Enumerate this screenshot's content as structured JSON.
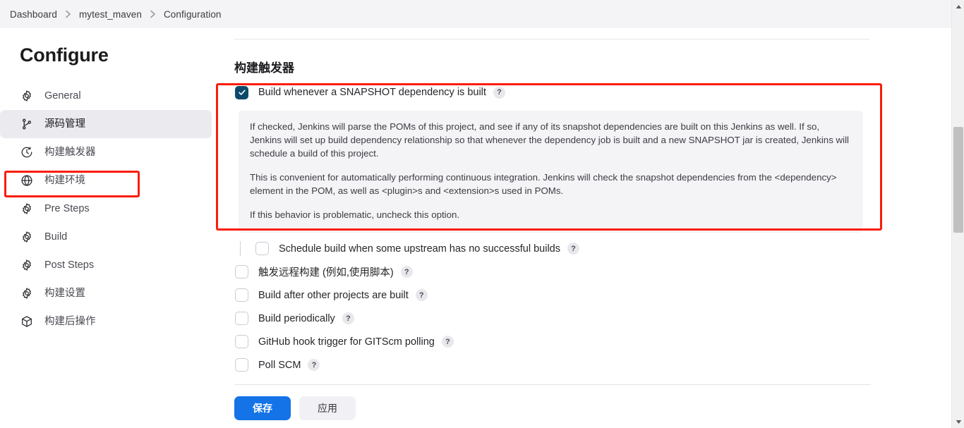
{
  "breadcrumb": {
    "items": [
      {
        "label": "Dashboard"
      },
      {
        "label": "mytest_maven"
      },
      {
        "label": "Configuration"
      }
    ],
    "separator_icon": "chevron-right-icon"
  },
  "sidebar": {
    "title": "Configure",
    "items": [
      {
        "label": "General",
        "icon": "gear-icon",
        "active": false
      },
      {
        "label": "源码管理",
        "icon": "source-branch-icon",
        "active": true
      },
      {
        "label": "构建触发器",
        "icon": "clock-icon",
        "active": false,
        "highlighted": true
      },
      {
        "label": "构建环境",
        "icon": "globe-icon",
        "active": false
      },
      {
        "label": "Pre Steps",
        "icon": "gear-icon",
        "active": false
      },
      {
        "label": "Build",
        "icon": "gear-icon",
        "active": false
      },
      {
        "label": "Post Steps",
        "icon": "gear-icon",
        "active": false
      },
      {
        "label": "构建设置",
        "icon": "gear-icon",
        "active": false
      },
      {
        "label": "构建后操作",
        "icon": "package-icon",
        "active": false
      }
    ]
  },
  "main": {
    "section_title": "构建触发器",
    "primary_trigger": {
      "label": "Build whenever a SNAPSHOT dependency is built",
      "checked": true,
      "help_badge": "?",
      "description": {
        "paragraph1": "If checked, Jenkins will parse the POMs of this project, and see if any of its snapshot dependencies are built on this Jenkins as well. If so, Jenkins will set up build dependency relationship so that whenever the dependency job is built and a new SNAPSHOT jar is created, Jenkins will schedule a build of this project.",
        "paragraph2": "This is convenient for automatically performing continuous integration. Jenkins will check the snapshot dependencies from the <dependency> element in the POM, as well as <plugin>s and <extension>s used in POMs.",
        "paragraph3": "If this behavior is problematic, uncheck this option."
      }
    },
    "triggers": [
      {
        "label": "Schedule build when some upstream has no successful builds",
        "checked": false,
        "indented": true,
        "help_badge": "?"
      },
      {
        "label": "触发远程构建 (例如,使用脚本)",
        "checked": false,
        "indented": false,
        "help_badge": "?"
      },
      {
        "label": "Build after other projects are built",
        "checked": false,
        "indented": false,
        "help_badge": "?"
      },
      {
        "label": "Build periodically",
        "checked": false,
        "indented": false,
        "help_badge": "?"
      },
      {
        "label": "GitHub hook trigger for GITScm polling",
        "checked": false,
        "indented": false,
        "help_badge": "?"
      },
      {
        "label": "Poll SCM",
        "checked": false,
        "indented": false,
        "help_badge": "?"
      }
    ]
  },
  "footer": {
    "save_label": "保存",
    "apply_label": "应用"
  },
  "annotations": {
    "highlight_color": "#fa1d09",
    "sidebar_highlight_target": "构建触发器",
    "main_highlight_target": "Build whenever a SNAPSHOT dependency is built"
  },
  "colors": {
    "accent_blue": "#1473e6",
    "checkbox_checked": "#0c4a6b",
    "header_bg": "#f4f4f6",
    "desc_bg": "#f4f4f7"
  },
  "scrollbar": {
    "up_icon": "caret-up-icon",
    "down_icon": "caret-down-icon"
  }
}
